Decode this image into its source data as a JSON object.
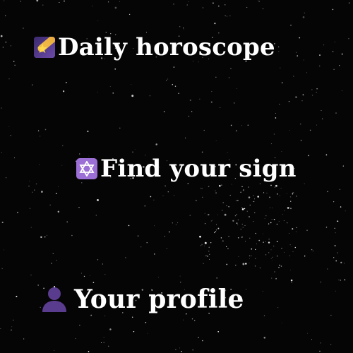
{
  "menu": {
    "items": [
      {
        "label": "Daily horoscope",
        "icon": "shooting-star-icon"
      },
      {
        "label": "Find your sign",
        "icon": "six-pointed-star-icon"
      },
      {
        "label": "Your profile",
        "icon": "user-silhouette-icon"
      }
    ]
  },
  "colors": {
    "background": "#050505",
    "text": "#ffffff",
    "icon_purple": "#9b6fd6",
    "icon_person": "#5a3c8e"
  }
}
